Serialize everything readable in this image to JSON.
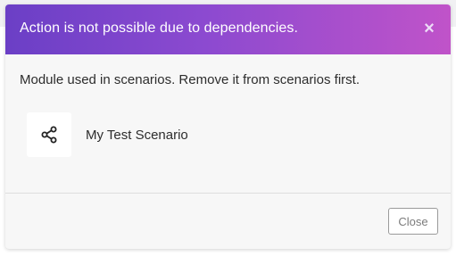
{
  "dialog": {
    "title": "Action is not possible due to dependencies.",
    "close_icon": "close-icon",
    "message": "Module used in scenarios. Remove it from scenarios first.",
    "scenarios": [
      {
        "name": "My Test Scenario",
        "icon": "share-nodes-icon"
      }
    ],
    "close_button_label": "Close"
  },
  "colors": {
    "header_gradient_start": "#6b3fc6",
    "header_gradient_end": "#c053c9",
    "dialog_background": "#f7f7f7"
  }
}
